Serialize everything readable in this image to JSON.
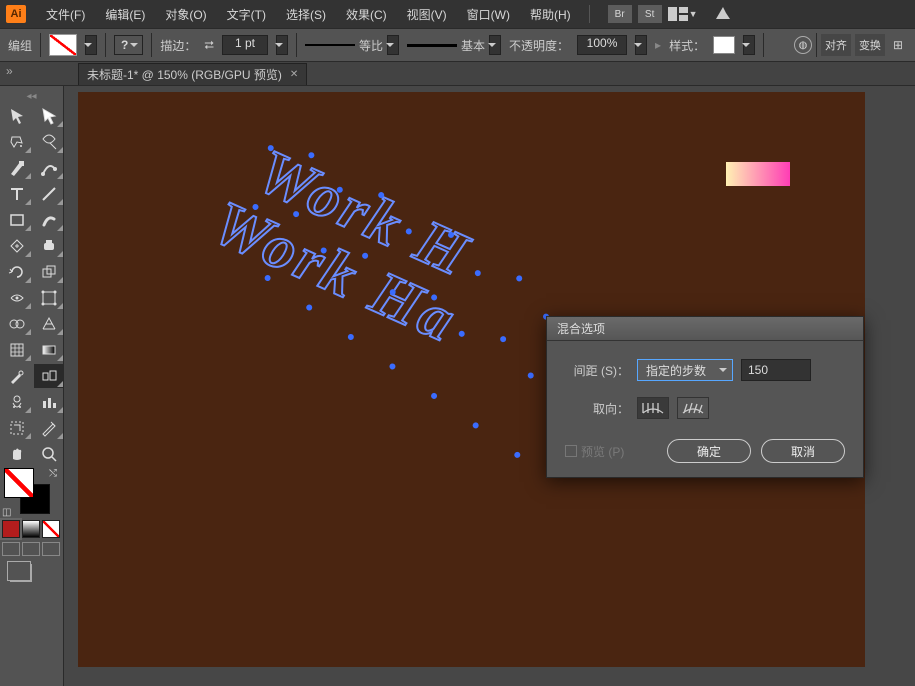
{
  "menubar": {
    "logo": "Ai",
    "items": [
      "文件(F)",
      "编辑(E)",
      "对象(O)",
      "文字(T)",
      "选择(S)",
      "效果(C)",
      "视图(V)",
      "窗口(W)",
      "帮助(H)"
    ],
    "side_icons": [
      "Br",
      "St"
    ]
  },
  "controlbar": {
    "selection_label": "编组",
    "stroke_label": "描边：",
    "stroke_width": "1 pt",
    "dash_label": "等比",
    "profile_label": "基本",
    "opacity_label": "不透明度：",
    "opacity_value": "100%",
    "style_label": "样式：",
    "btn_align": "对齐",
    "btn_transform": "变换"
  },
  "tab": {
    "title": "未标题-1* @ 150% (RGB/GPU 预览)"
  },
  "canvas": {
    "text_row1": "Work H",
    "text_row2": "Work Ha"
  },
  "dialog": {
    "title": "混合选项",
    "spacing_label": "间距 (S)：",
    "spacing_mode": "指定的步数",
    "spacing_value": "150",
    "orient_label": "取向：",
    "preview_label": "预览 (P)",
    "ok": "确定",
    "cancel": "取消"
  },
  "tools": {
    "names": [
      "selection-tool",
      "direct-selection-tool",
      "magic-wand-tool",
      "lasso-tool",
      "pen-tool",
      "curvature-tool",
      "type-tool",
      "line-tool",
      "rectangle-tool",
      "paintbrush-tool",
      "shaper-tool",
      "eraser-tool",
      "rotate-tool",
      "scale-tool",
      "width-tool",
      "free-transform-tool",
      "shape-builder-tool",
      "perspective-grid-tool",
      "mesh-tool",
      "gradient-tool",
      "eyedropper-tool",
      "blend-tool",
      "symbol-sprayer-tool",
      "column-graph-tool",
      "artboard-tool",
      "slice-tool",
      "hand-tool",
      "zoom-tool"
    ]
  }
}
